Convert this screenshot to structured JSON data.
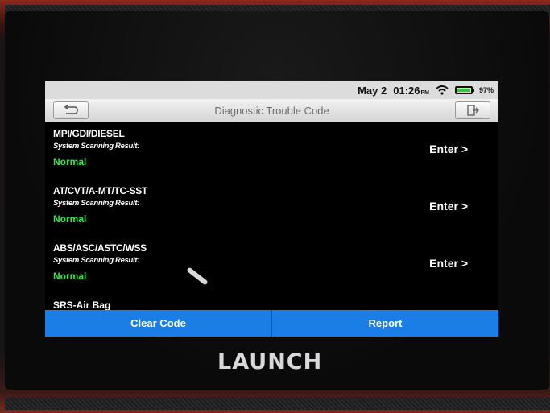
{
  "status_bar": {
    "date": "May 2",
    "time": "01:26",
    "ampm": "PM",
    "battery": "97%",
    "battery_level": 0.97
  },
  "title_bar": {
    "title": "Diagnostic Trouble Code",
    "back_icon": "back-arrow-icon",
    "exit_icon": "exit-door-icon"
  },
  "systems": [
    {
      "name": "MPI/GDI/DIESEL",
      "label": "System Scanning Result:",
      "status": "Normal",
      "action": "Enter >"
    },
    {
      "name": "AT/CVT/A-MT/TC-SST",
      "label": "System Scanning Result:",
      "status": "Normal",
      "action": "Enter >"
    },
    {
      "name": "ABS/ASC/ASTC/WSS",
      "label": "System Scanning Result:",
      "status": "Normal",
      "action": "Enter >"
    }
  ],
  "partial_item": "SRS-Air Bag",
  "buttons": {
    "clear_code": "Clear Code",
    "report": "Report"
  },
  "brand": "LAUNCH",
  "colors": {
    "accent": "#1b7ee6",
    "status_ok": "#2ee84a"
  }
}
